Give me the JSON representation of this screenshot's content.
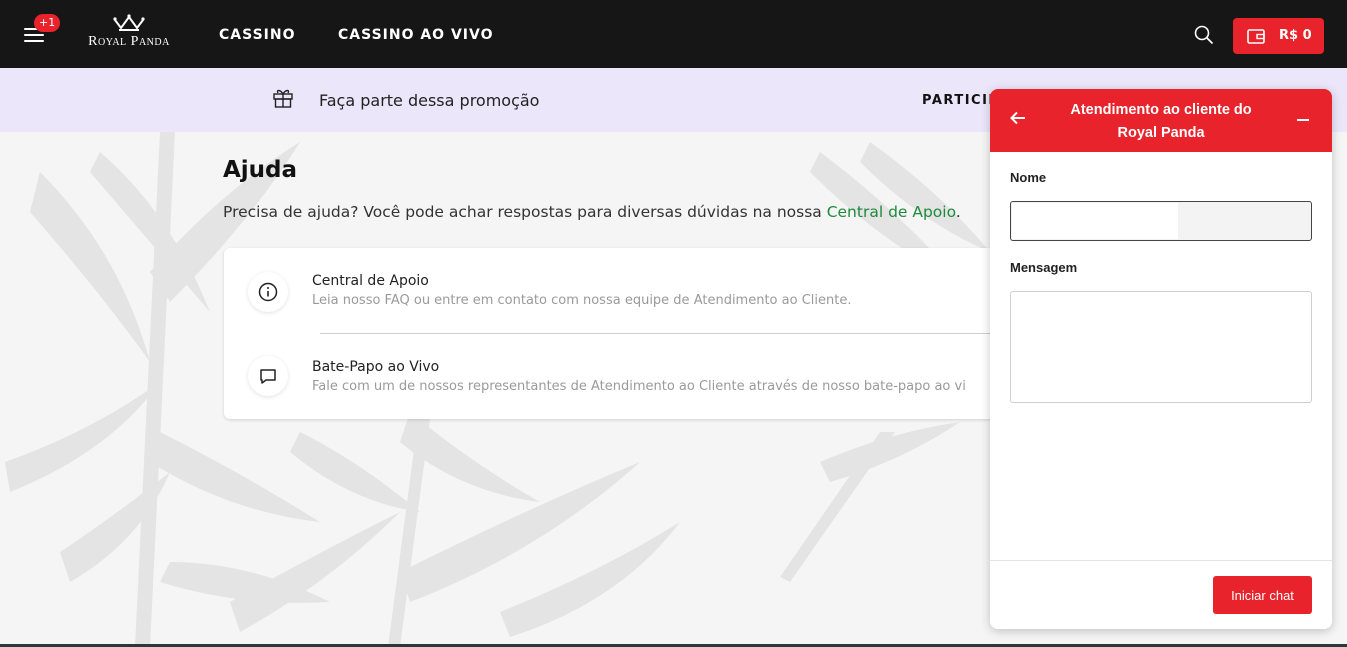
{
  "header": {
    "notification_badge": "+1",
    "logo_text": "Royal Panda",
    "nav": [
      "CASSINO",
      "CASSINO AO VIVO"
    ],
    "wallet_amount": "R$ 0",
    "brand_color": "#e8232b"
  },
  "promo": {
    "text": "Faça parte dessa promoção",
    "cta": "PARTICIP"
  },
  "help": {
    "title": "Ajuda",
    "description_prefix": "Precisa de ajuda? Você pode achar respostas para diversas dúvidas na nossa ",
    "description_link": "Central de Apoio",
    "description_suffix": ".",
    "items": [
      {
        "icon": "info-icon",
        "title": "Central de Apoio",
        "subtitle": "Leia nosso FAQ ou entre em contato com nossa equipe de Atendimento ao Cliente."
      },
      {
        "icon": "chat-bubble-icon",
        "title": "Bate-Papo ao Vivo",
        "subtitle": "Fale com um de nossos representantes de Atendimento ao Cliente através de nosso bate-papo ao vi"
      }
    ]
  },
  "chat": {
    "title": "Atendimento ao cliente do Royal Panda",
    "name_label": "Nome",
    "name_value": "",
    "message_label": "Mensagem",
    "message_value": "",
    "start_button": "Iniciar chat"
  }
}
